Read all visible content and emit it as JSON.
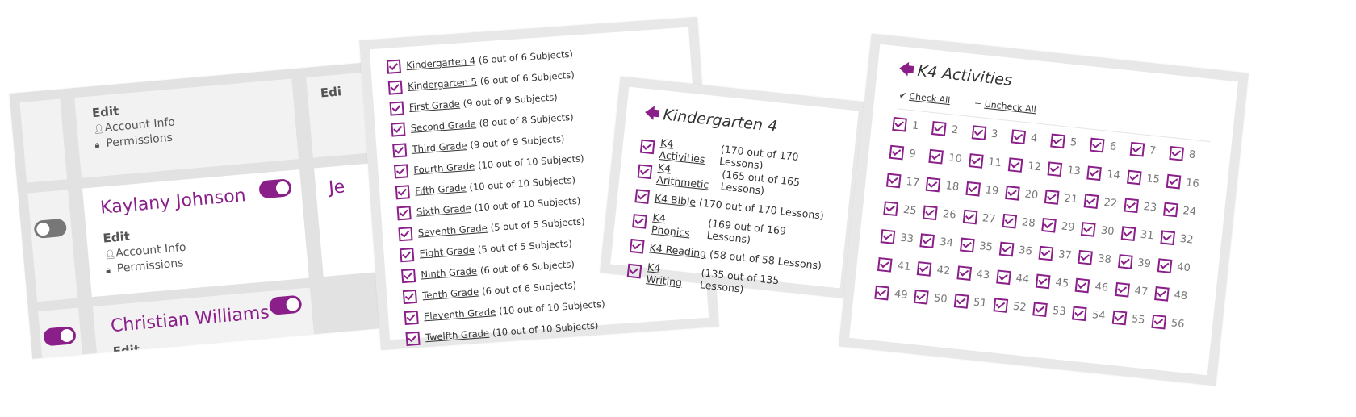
{
  "accent": "#8a1f8a",
  "users": {
    "edit_label": "Edit",
    "account_info_label": "Account Info",
    "permissions_label": "Permissions",
    "users": [
      {
        "name": "Kaylany Johnson",
        "toggle_on": true,
        "left_toggle_on": false
      },
      {
        "name": "Christian Williams",
        "toggle_on": true,
        "left_toggle_on": true
      }
    ],
    "partial_name": "Je",
    "partial_edit": "Edi"
  },
  "grades": {
    "items": [
      {
        "label": "Kindergarten 4",
        "count": "(6 out of 6 Subjects)"
      },
      {
        "label": "Kindergarten 5",
        "count": "(6 out of 6 Subjects)"
      },
      {
        "label": "First Grade",
        "count": "(9 out of 9 Subjects)"
      },
      {
        "label": "Second Grade",
        "count": "(8 out of 8 Subjects)"
      },
      {
        "label": "Third Grade",
        "count": "(9 out of 9 Subjects)"
      },
      {
        "label": "Fourth Grade",
        "count": "(10 out of 10 Subjects)"
      },
      {
        "label": "Fifth Grade",
        "count": "(10 out of 10 Subjects)"
      },
      {
        "label": "Sixth Grade",
        "count": "(10 out of 10 Subjects)"
      },
      {
        "label": "Seventh Grade",
        "count": "(5 out of 5 Subjects)"
      },
      {
        "label": "Eight Grade",
        "count": "(5 out of 5 Subjects)"
      },
      {
        "label": "Ninth Grade",
        "count": "(6 out of 6 Subjects)"
      },
      {
        "label": "Tenth Grade",
        "count": "(6 out of 6 Subjects)"
      },
      {
        "label": "Eleventh Grade",
        "count": "(10 out of 10 Subjects)"
      },
      {
        "label": "Twelfth Grade",
        "count": "(10 out of 10 Subjects)"
      }
    ]
  },
  "k4": {
    "title": "Kindergarten 4",
    "items": [
      {
        "label": "K4 Activities",
        "count": "(170 out of 170 Lessons)"
      },
      {
        "label": "K4 Arithmetic",
        "count": "(165 out of 165 Lessons)"
      },
      {
        "label": "K4 Bible",
        "count": "(170 out of 170 Lessons)"
      },
      {
        "label": "K4 Phonics",
        "count": "(169 out of 169 Lessons)"
      },
      {
        "label": "K4 Reading",
        "count": "(58 out of 58 Lessons)"
      },
      {
        "label": "K4 Writing",
        "count": "(135 out of 135 Lessons)"
      }
    ]
  },
  "activities": {
    "title": "K4 Activities",
    "check_all": "Check All",
    "uncheck_all": "Uncheck All",
    "lessons": [
      "1",
      "2",
      "3",
      "4",
      "5",
      "6",
      "7",
      "8",
      "9",
      "10",
      "11",
      "12",
      "13",
      "14",
      "15",
      "16",
      "17",
      "18",
      "19",
      "20",
      "21",
      "22",
      "23",
      "24",
      "25",
      "26",
      "27",
      "28",
      "29",
      "30",
      "31",
      "32",
      "33",
      "34",
      "35",
      "36",
      "37",
      "38",
      "39",
      "40",
      "41",
      "42",
      "43",
      "44",
      "45",
      "46",
      "47",
      "48",
      "49",
      "50",
      "51",
      "52",
      "53",
      "54",
      "55",
      "56"
    ]
  }
}
